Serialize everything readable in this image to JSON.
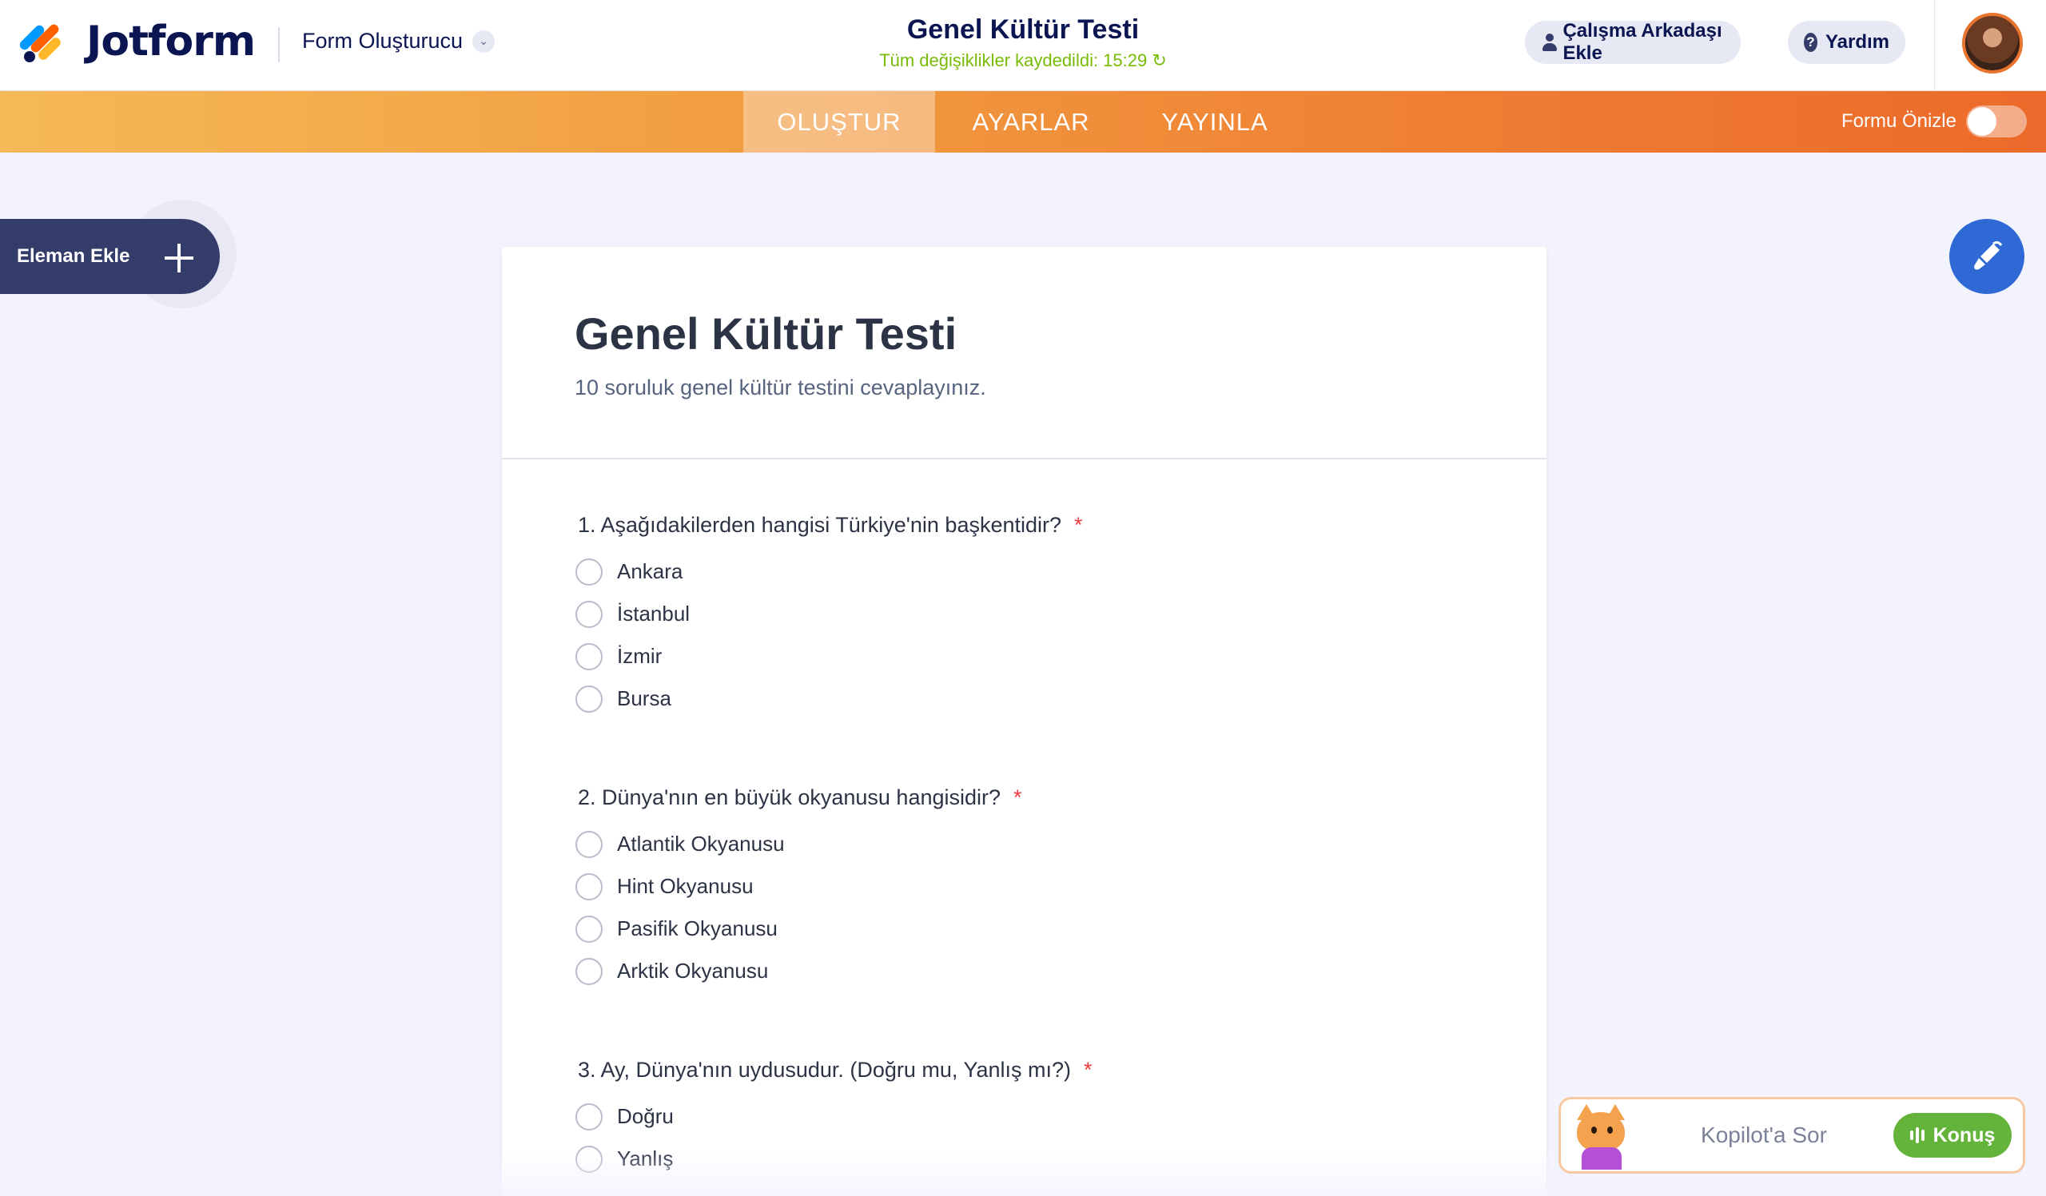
{
  "header": {
    "logo_text": "Jotform",
    "builder_menu_label": "Form Oluşturucu",
    "form_title": "Genel Kültür Testi",
    "save_status": "Tüm değişiklikler kaydedildi: 15:29 ↻",
    "invite_label": "Çalışma Arkadaşı Ekle",
    "help_label": "Yardım"
  },
  "nav": {
    "tabs": [
      {
        "label": "OLUŞTUR",
        "active": true
      },
      {
        "label": "AYARLAR",
        "active": false
      },
      {
        "label": "YAYINLA",
        "active": false
      }
    ],
    "preview_label": "Formu Önizle",
    "preview_on": false
  },
  "sidebar": {
    "add_element_label": "Eleman Ekle"
  },
  "form": {
    "title": "Genel Kültür Testi",
    "subtitle": "10 soruluk genel kültür testini cevaplayınız.",
    "questions": [
      {
        "label": "1. Aşağıdakilerden hangisi Türkiye'nin başkentidir?",
        "required": "*",
        "options": [
          "Ankara",
          "İstanbul",
          "İzmir",
          "Bursa"
        ]
      },
      {
        "label": "2. Dünya'nın en büyük okyanusu hangisidir?",
        "required": "*",
        "options": [
          "Atlantik Okyanusu",
          "Hint Okyanusu",
          "Pasifik Okyanusu",
          "Arktik Okyanusu"
        ]
      },
      {
        "label": "3. Ay, Dünya'nın uydusudur. (Doğru mu, Yanlış mı?)",
        "required": "*",
        "options": [
          "Doğru",
          "Yanlış"
        ]
      }
    ]
  },
  "copilot": {
    "placeholder": "Kopilot'a Sor",
    "talk_label": "Konuş"
  },
  "colors": {
    "brand_navy": "#0a1551",
    "nav_gradient_start": "#f5b957",
    "nav_gradient_end": "#ec6a2b",
    "save_status": "#78bb07",
    "required": "#f23a3c",
    "designer_button": "#2e69d6",
    "talk_button": "#64b33a"
  }
}
